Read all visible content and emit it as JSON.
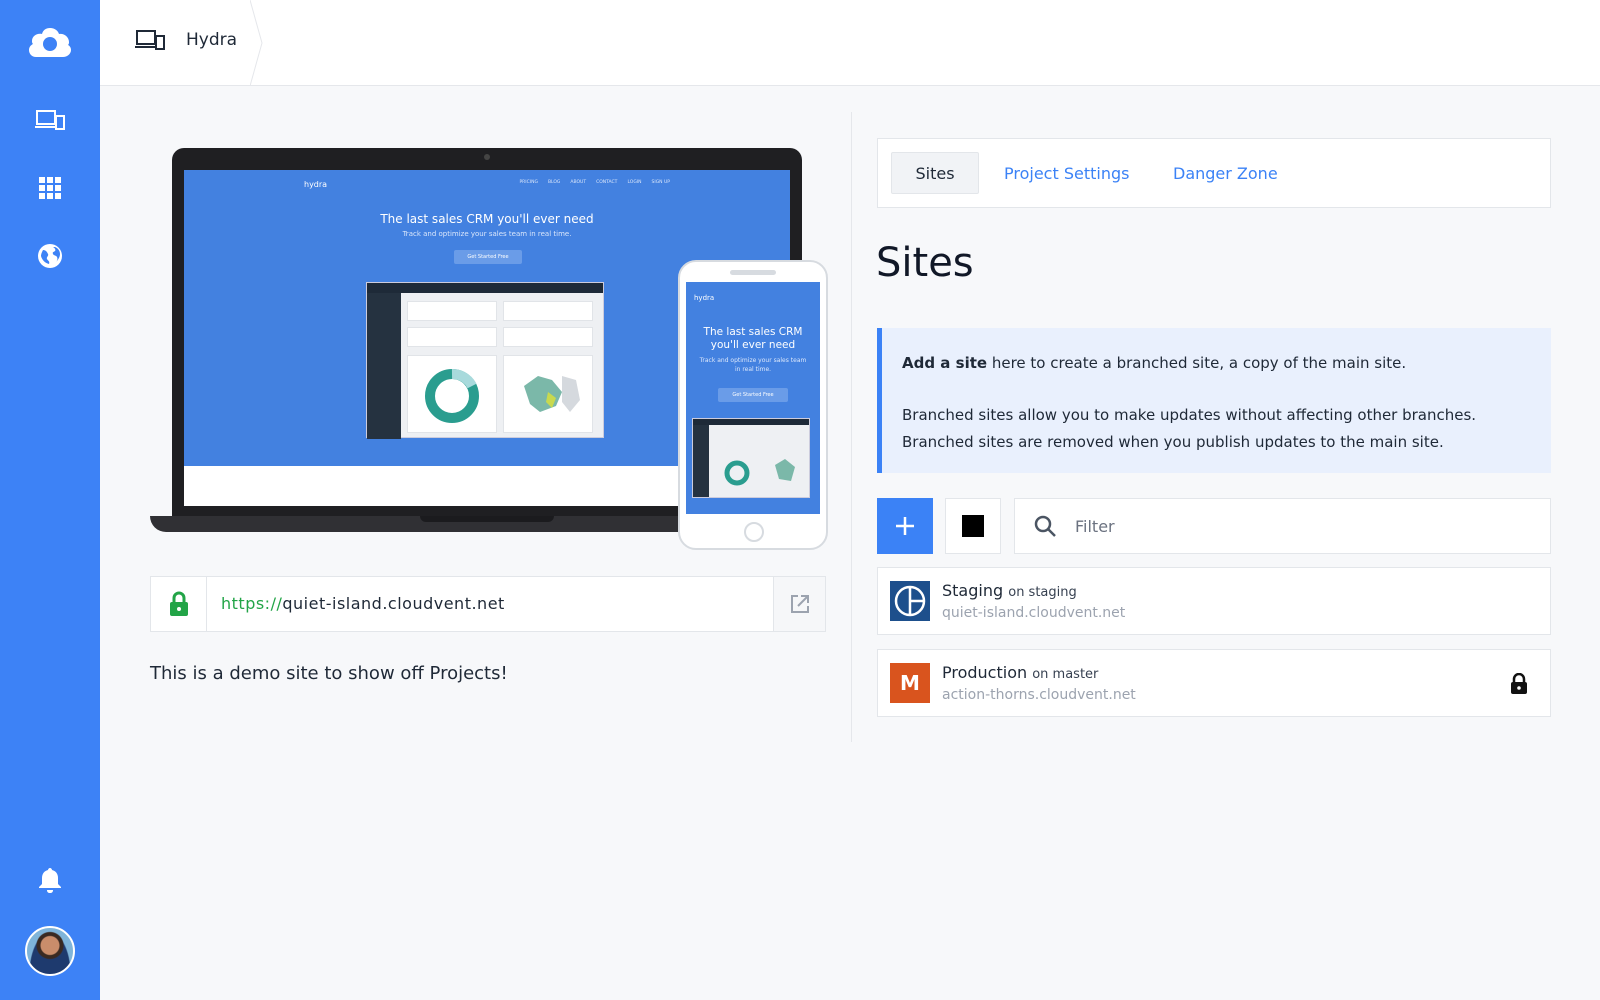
{
  "sidebar": {
    "icons": [
      "cloud-logo-icon",
      "devices-icon",
      "apps-grid-icon",
      "globe-icon",
      "bell-icon"
    ],
    "accent": "#3d82f6"
  },
  "topbar": {
    "project_name": "Hydra"
  },
  "preview": {
    "laptop": {
      "logo": "hydra",
      "nav": [
        "PRICING",
        "BLOG",
        "ABOUT",
        "CONTACT",
        "LOGIN",
        "SIGN UP"
      ],
      "hero_title": "The last sales CRM you'll ever need",
      "hero_subtitle": "Track and optimize your sales team in real time.",
      "hero_button": "Get Started Free"
    },
    "phone": {
      "logo": "hydra",
      "hero_title": "The last sales CRM you'll ever need",
      "hero_subtitle": "Track and optimize your sales team in real time.",
      "hero_button": "Get Started Free"
    }
  },
  "url": {
    "protocol": "https://",
    "host": "quiet-island.cloudvent.net"
  },
  "description": "This is a demo site to show off Projects!",
  "tabs": {
    "sites": "Sites",
    "project_settings": "Project Settings",
    "danger_zone": "Danger Zone"
  },
  "heading": "Sites",
  "info": {
    "line1_bold": "Add a site",
    "line1_rest": " here to create a branched site, a copy of the main site.",
    "line2": "Branched sites allow you to make updates without affecting other branches.",
    "line3": "Branched sites are removed when you publish updates to the main site."
  },
  "toolbar": {
    "filter_placeholder": "Filter"
  },
  "sites": [
    {
      "name": "Staging",
      "branch": "on staging",
      "url": "quiet-island.cloudvent.net",
      "badge": "",
      "badge_color": "#1d4f8c",
      "locked": false
    },
    {
      "name": "Production",
      "branch": "on master",
      "url": "action-thorns.cloudvent.net",
      "badge": "M",
      "badge_color": "#d9541e",
      "locked": true
    }
  ]
}
